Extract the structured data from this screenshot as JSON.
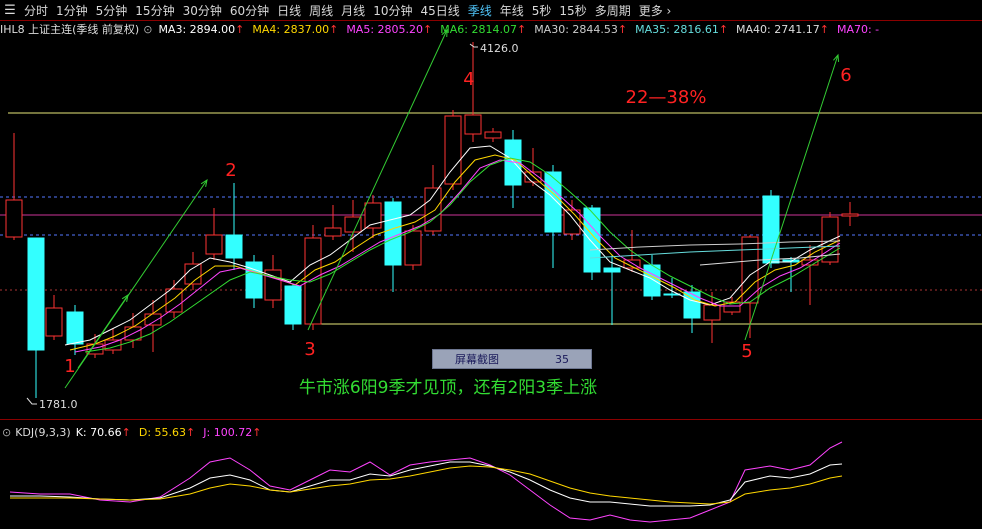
{
  "toolbar": {
    "tabs": [
      "分时",
      "1分钟",
      "5分钟",
      "15分钟",
      "30分钟",
      "60分钟",
      "日线",
      "周线",
      "月线",
      "10分钟",
      "45日线",
      "季线",
      "年线",
      "5秒",
      "15秒",
      "多周期"
    ],
    "active_index": 11,
    "more_label": "更多"
  },
  "main_panel": {
    "instrument": "IHL8 上证主连(季线 前复权)",
    "ma": [
      {
        "label": "MA3: 2894.00",
        "arrow": "↑",
        "color": "#ffffff"
      },
      {
        "label": "MA4: 2837.00",
        "arrow": "↑",
        "color": "#ffd700"
      },
      {
        "label": "MA5: 2805.20",
        "arrow": "↑",
        "color": "#ff44ff"
      },
      {
        "label": "MA6: 2814.07",
        "arrow": "↑",
        "color": "#33dd33"
      },
      {
        "label": "MA30: 2844.53",
        "arrow": "↑",
        "color": "#cccccc"
      },
      {
        "label": "MA35: 2816.61",
        "arrow": "↑",
        "color": "#66dddd"
      },
      {
        "label": "MA40: 2741.17",
        "arrow": "↑",
        "color": "#dddddd"
      },
      {
        "label": "MA70: -",
        "arrow": "",
        "color": "#ff44ff"
      }
    ],
    "high_label": "4126.0",
    "low_label": "1781.0",
    "range_text": "22—38%",
    "note_text": "牛市涨6阳9季才见顶，还有2阳3季上涨",
    "wave_labels": [
      "1",
      "2",
      "3",
      "4",
      "5",
      "6"
    ],
    "overlay": {
      "label": "屏幕截图",
      "value": "35"
    }
  },
  "kdj_panel": {
    "name": "KDJ(9,3,3)",
    "k": {
      "label": "K: 70.66",
      "arrow": "↑",
      "color": "#ffffff"
    },
    "d": {
      "label": "D: 55.63",
      "arrow": "↑",
      "color": "#ffd700"
    },
    "j": {
      "label": "J: 100.72",
      "arrow": "↑",
      "color": "#ff44ff"
    }
  },
  "colors": {
    "up": "#ff3333",
    "down": "#33ffff",
    "accent": "#4fc3f7",
    "note": "#33dd33",
    "label": "#ff2222"
  }
}
